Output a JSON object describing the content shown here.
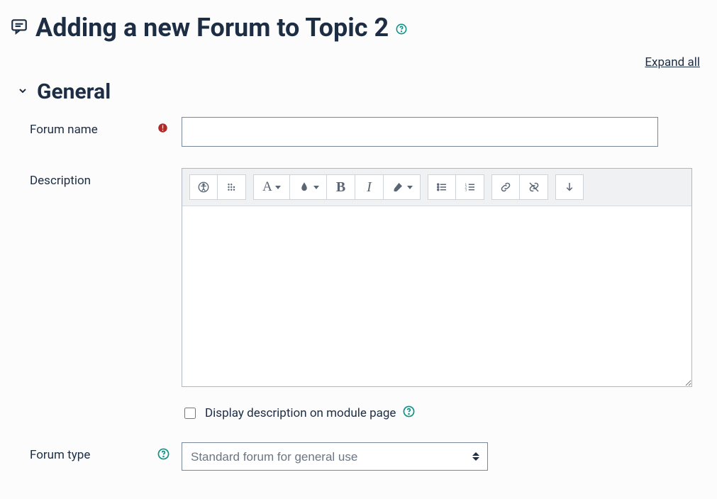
{
  "page": {
    "title": "Adding a new Forum to Topic 2",
    "expand_all": "Expand all"
  },
  "section_general": {
    "heading": "General",
    "forum_name_label": "Forum name",
    "forum_name_value": "",
    "description_label": "Description",
    "description_value": "",
    "display_description_label": "Display description on module page",
    "display_description_checked": false,
    "forum_type_label": "Forum type",
    "forum_type_value": "Standard forum for general use"
  },
  "editor": {
    "btn_accessibility": "accessibility-checker",
    "btn_screenreader": "screenreader-helper",
    "btn_font": "A",
    "btn_textcolor": "text-color",
    "btn_bold": "B",
    "btn_italic": "I",
    "btn_brush": "brush",
    "btn_ul": "bulleted-list",
    "btn_ol": "numbered-list",
    "btn_link": "link",
    "btn_unlink": "unlink",
    "btn_more": "show-more"
  }
}
